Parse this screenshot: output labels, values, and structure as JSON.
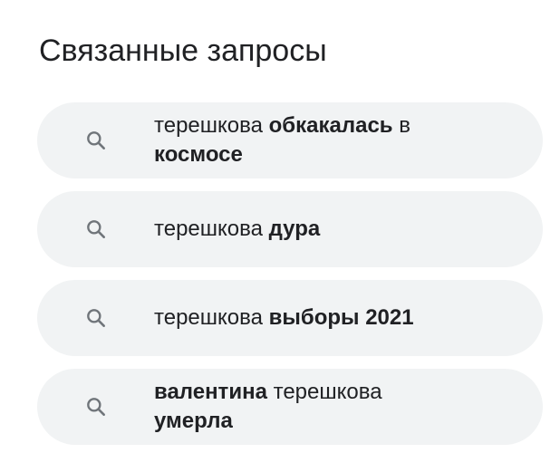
{
  "heading": "Связанные запросы",
  "queries": [
    {
      "parts": [
        "терешкова ",
        "обкакалась",
        " в ",
        "космосе"
      ]
    },
    {
      "parts": [
        "терешкова ",
        "дура"
      ]
    },
    {
      "parts": [
        "терешкова ",
        "выборы 2021"
      ]
    },
    {
      "parts": [
        "валентина",
        " терешкова ",
        "умерла"
      ]
    }
  ],
  "icons": {
    "search": "search-icon"
  },
  "colors": {
    "chip_bg": "#f1f3f4",
    "text": "#202124",
    "icon": "#70757a"
  }
}
